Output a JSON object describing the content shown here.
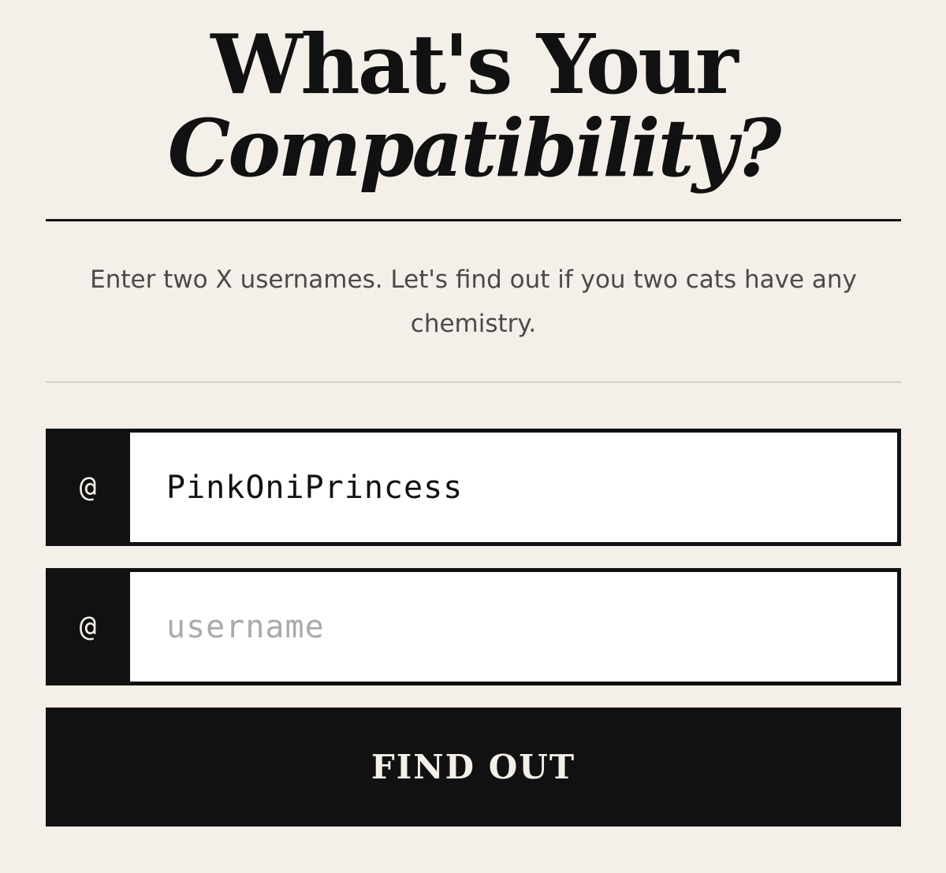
{
  "heading": {
    "line1": "What's Your",
    "line2": "Compatibility?"
  },
  "intro": {
    "text": "Enter two X usernames. Let's find out if you two cats have any chemistry."
  },
  "form": {
    "user1": {
      "prefix": "@",
      "value": "PinkOniPrincess",
      "placeholder": "username"
    },
    "user2": {
      "prefix": "@",
      "value": "",
      "placeholder": "username"
    },
    "submit_label": "FIND OUT"
  },
  "colors": {
    "background": "#f4efe8",
    "ink": "#111111",
    "muted_text": "#4a4a4a",
    "divider": "#d5d1ca",
    "input_bg": "#ffffff",
    "placeholder": "#aaaaaa"
  }
}
